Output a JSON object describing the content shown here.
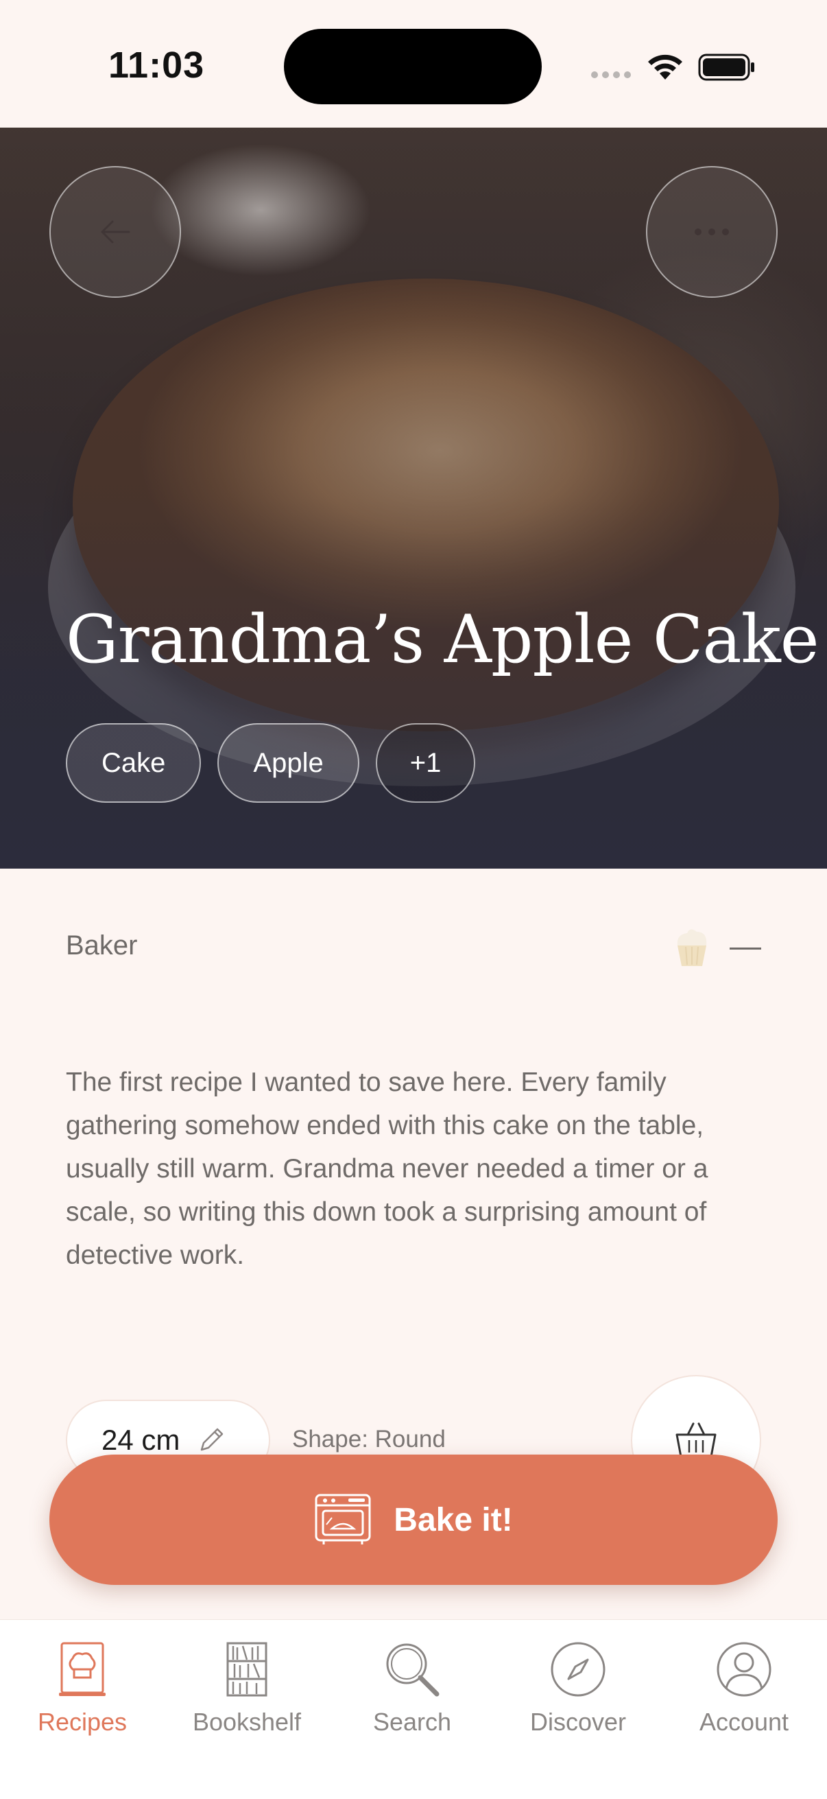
{
  "status_bar": {
    "time": "11:03"
  },
  "hero": {
    "title": "Grandma’s Apple Cake",
    "tags": [
      "Cake",
      "Apple"
    ],
    "more_tags": "+1"
  },
  "baker": {
    "label": "Baker",
    "value": "—"
  },
  "description": "The first recipe I wanted to save here. Every family gathering somehow ended with this cake on the table, usually still warm. Grandma never needed a timer or a scale, so writing this down took a surprising amount of detective work.",
  "pan": {
    "size": "24 cm",
    "shape": "Shape: Round"
  },
  "bake_button": {
    "label": "Bake it!"
  },
  "tab_bar": {
    "items": [
      {
        "label": "Recipes",
        "icon": "recipe-book-icon",
        "active": true
      },
      {
        "label": "Bookshelf",
        "icon": "bookshelf-icon",
        "active": false
      },
      {
        "label": "Search",
        "icon": "search-icon",
        "active": false
      },
      {
        "label": "Discover",
        "icon": "compass-icon",
        "active": false
      },
      {
        "label": "Account",
        "icon": "account-icon",
        "active": false
      }
    ]
  },
  "colors": {
    "accent": "#df775a",
    "background": "#fdf5f2"
  }
}
